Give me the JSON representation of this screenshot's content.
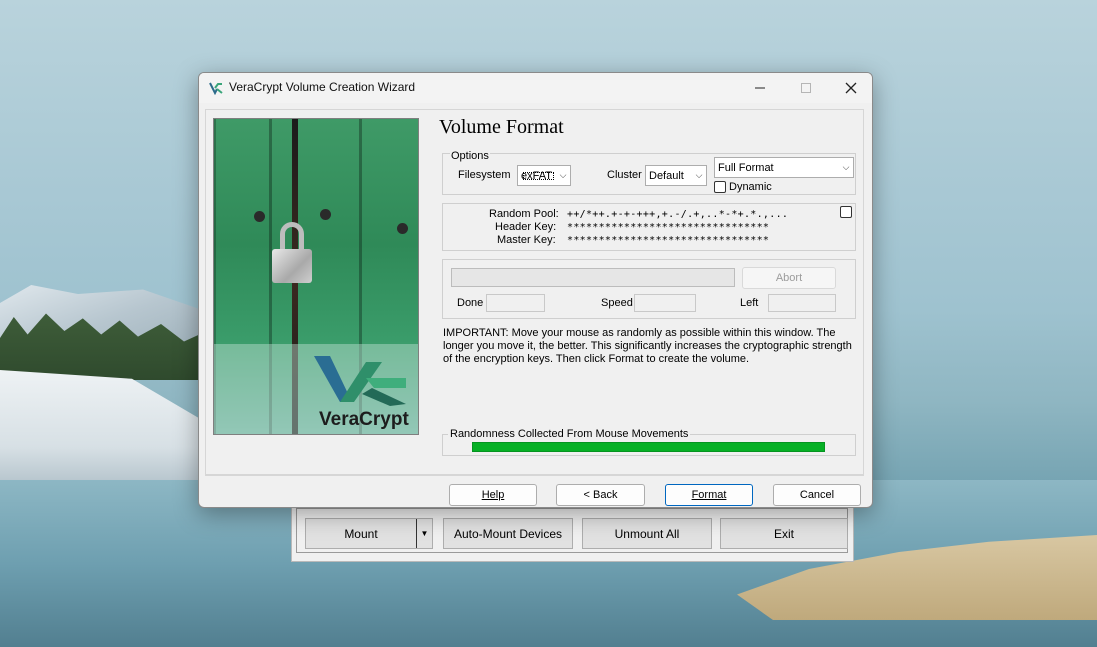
{
  "wizard": {
    "title": "VeraCrypt Volume Creation Wizard",
    "heading": "Volume Format",
    "options": {
      "group_label": "Options",
      "filesystem_label": "Filesystem",
      "filesystem_value": "exFAT",
      "cluster_label": "Cluster",
      "cluster_value": "Default",
      "format_mode_value": "Full Format",
      "dynamic_label": "Dynamic",
      "dynamic_checked": false
    },
    "keys": {
      "random_pool_label": "Random Pool:",
      "random_pool_value": "++/*++.+-+-+++,+.-/.+,..*-*+.*.,...",
      "header_key_label": "Header Key:",
      "header_key_value": "********************************",
      "master_key_label": "Master Key:",
      "master_key_value": "********************************",
      "show_checked": false
    },
    "progress": {
      "abort_label": "Abort",
      "done_label": "Done",
      "speed_label": "Speed",
      "left_label": "Left",
      "fraction": 0
    },
    "notice": "IMPORTANT: Move your mouse as randomly as possible within this window. The longer you move it, the better. This significantly increases the cryptographic strength of the encryption keys. Then click Format to create the volume.",
    "randomness": {
      "label": "Randomness Collected From Mouse Movements",
      "fraction": 1.0,
      "color": "#06b025"
    },
    "buttons": {
      "help": "Help",
      "back": "< Back",
      "format": "Format",
      "cancel": "Cancel"
    },
    "logo_text": "VeraCrypt"
  },
  "main_window": {
    "buttons": {
      "mount": "Mount",
      "auto_mount": "Auto-Mount Devices",
      "unmount_all": "Unmount All",
      "exit": "Exit"
    }
  },
  "icons": {
    "title_logo": "veracrypt-logo-icon",
    "minimize": "minimize-icon",
    "maximize": "maximize-icon",
    "close": "close-icon"
  },
  "colors": {
    "accent": "#0067c0",
    "progress_green": "#06b025"
  }
}
